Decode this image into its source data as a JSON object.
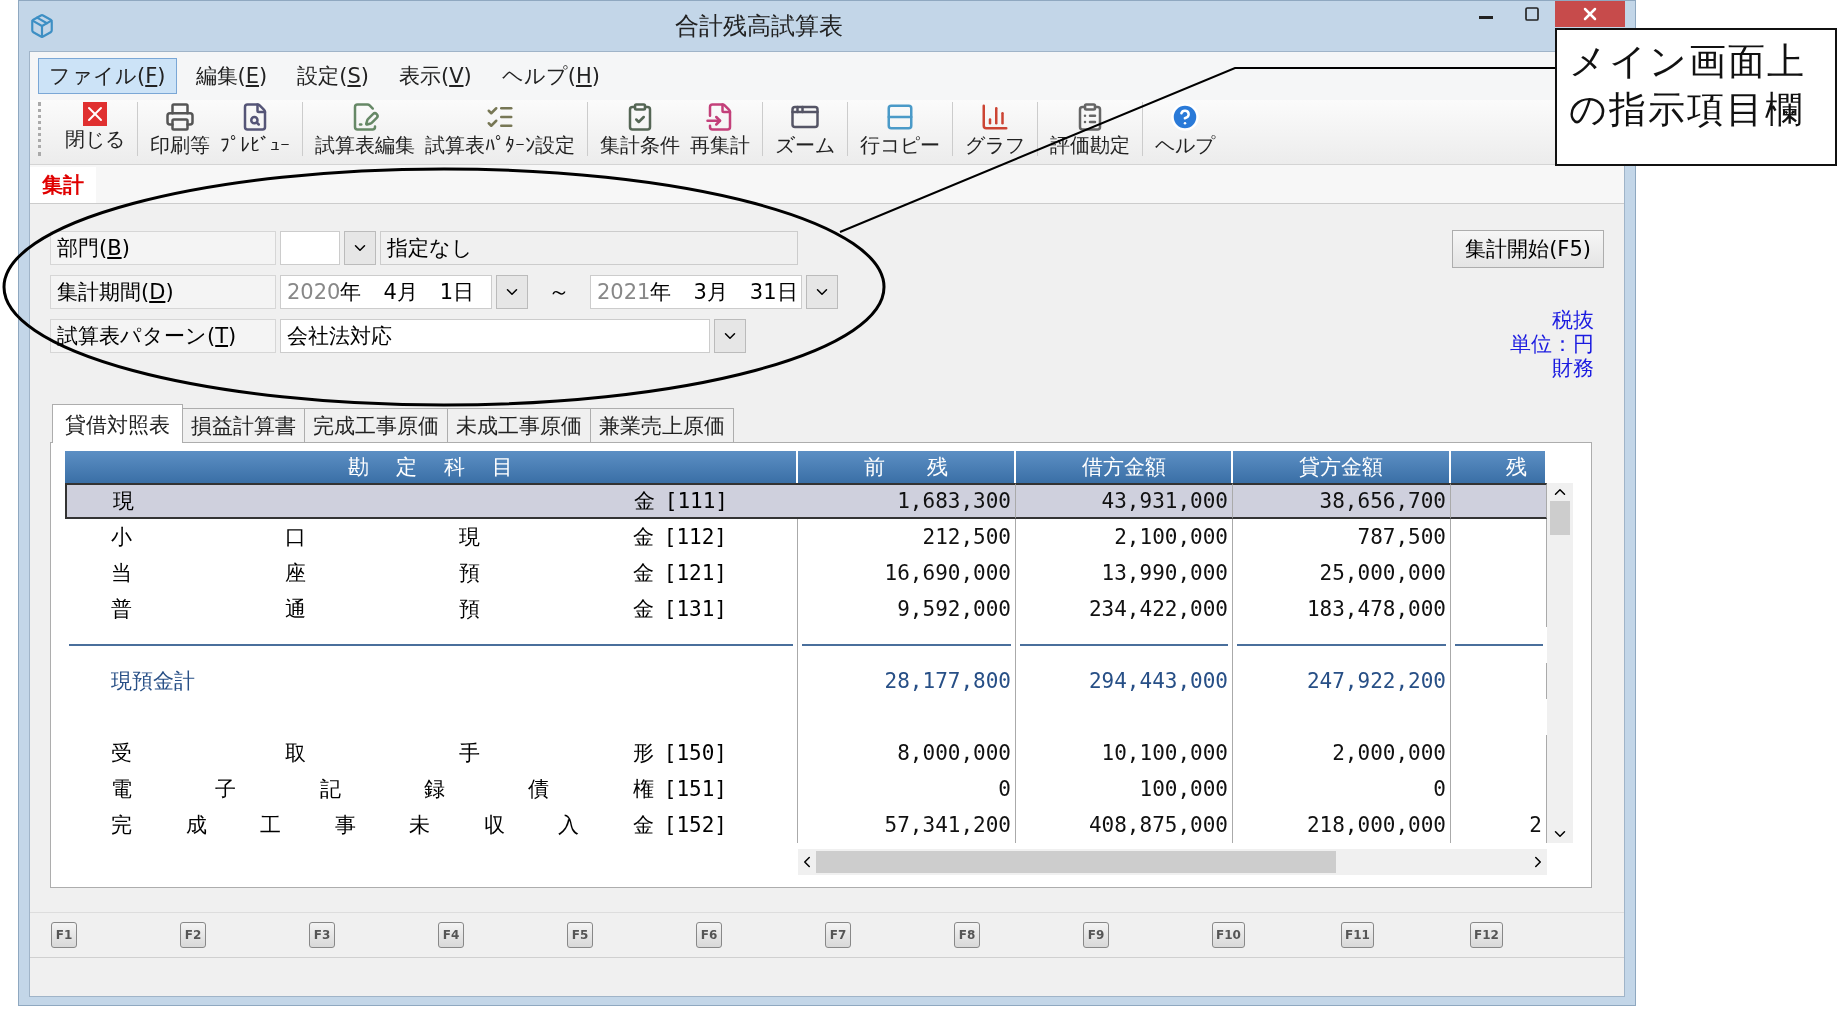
{
  "window": {
    "title": "合計残高試算表"
  },
  "menu": [
    {
      "label": "ファイル(F)",
      "selected": true
    },
    {
      "label": "編集(E)",
      "selected": false
    },
    {
      "label": "設定(S)",
      "selected": false
    },
    {
      "label": "表示(V)",
      "selected": false
    },
    {
      "label": "ヘルプ(H)",
      "selected": false
    }
  ],
  "toolbar": [
    [
      {
        "label": "閉じる"
      }
    ],
    [
      {
        "label": "印刷等"
      },
      {
        "label": "ﾌﾟﾚﾋﾞｭｰ"
      }
    ],
    [
      {
        "label": "試算表編集"
      },
      {
        "label": "試算表ﾊﾟﾀｰﾝ設定"
      }
    ],
    [
      {
        "label": "集計条件"
      },
      {
        "label": "再集計"
      }
    ],
    [
      {
        "label": "ズーム"
      }
    ],
    [
      {
        "label": "行コピー"
      }
    ],
    [
      {
        "label": "グラフ"
      }
    ],
    [
      {
        "label": "評価勘定"
      }
    ],
    [
      {
        "label": "ヘルプ"
      }
    ]
  ],
  "section_tab": {
    "label": "集計"
  },
  "form": {
    "department": {
      "label": "部門(B)",
      "name": "指定なし"
    },
    "period": {
      "label": "集計期間(D)",
      "from": {
        "year": "2020",
        "year_unit": "年",
        "month": "4月",
        "day": "1日"
      },
      "separator": "～",
      "to": {
        "year": "2021",
        "year_unit": "年",
        "month": "3月",
        "day": "31日"
      }
    },
    "pattern": {
      "label": "試算表パターン(T)",
      "value": "会社法対応"
    }
  },
  "start_button": "集計開始(F5)",
  "notes": [
    "税抜",
    "単位：円",
    "財務"
  ],
  "tabs": [
    {
      "label": "貸借対照表",
      "selected": true
    },
    {
      "label": "損益計算書",
      "selected": false
    },
    {
      "label": "完成工事原価",
      "selected": false
    },
    {
      "label": "未成工事原価",
      "selected": false
    },
    {
      "label": "兼業売上原価",
      "selected": false
    }
  ],
  "table": {
    "columns": [
      "勘 定 科 目",
      "前　　残",
      "借方金額",
      "貸方金額",
      "残"
    ],
    "rows": [
      {
        "kind": "account",
        "name_chars": [
          "現",
          "金"
        ],
        "code": "[111]",
        "values": [
          "1,683,300",
          "43,931,000",
          "38,656,700"
        ],
        "selected": true
      },
      {
        "kind": "account",
        "name_chars": [
          "小",
          "口",
          "現",
          "金"
        ],
        "code": "[112]",
        "values": [
          "212,500",
          "2,100,000",
          "787,500"
        ],
        "selected": false
      },
      {
        "kind": "account",
        "name_chars": [
          "当",
          "座",
          "預",
          "金"
        ],
        "code": "[121]",
        "values": [
          "16,690,000",
          "13,990,000",
          "25,000,000"
        ],
        "selected": false
      },
      {
        "kind": "account",
        "name_chars": [
          "普",
          "通",
          "預",
          "金"
        ],
        "code": "[131]",
        "values": [
          "9,592,000",
          "234,422,000",
          "183,478,000"
        ],
        "selected": false
      },
      {
        "kind": "subtotal",
        "name": "現預金計",
        "values": [
          "28,177,800",
          "294,443,000",
          "247,922,200"
        ],
        "selected": false
      },
      {
        "kind": "account",
        "name_chars": [
          "受",
          "取",
          "手",
          "形"
        ],
        "code": "[150]",
        "values": [
          "8,000,000",
          "10,100,000",
          "2,000,000"
        ],
        "selected": false
      },
      {
        "kind": "account",
        "name_chars": [
          "電",
          "子",
          "記",
          "録",
          "債",
          "権"
        ],
        "code": "[151]",
        "values": [
          "0",
          "100,000",
          "0"
        ],
        "selected": false
      },
      {
        "kind": "account",
        "name_chars": [
          "完",
          "成",
          "工",
          "事",
          "未",
          "収",
          "入",
          "金"
        ],
        "code": "[152]",
        "values": [
          "57,341,200",
          "408,875,000",
          "218,000,000",
          "2"
        ],
        "selected": false
      }
    ]
  },
  "function_keys": [
    "F1",
    "F2",
    "F3",
    "F4",
    "F5",
    "F6",
    "F7",
    "F8",
    "F9",
    "F10",
    "F11",
    "F12"
  ],
  "callout": {
    "text": "メイン画面上の指示項目欄"
  }
}
